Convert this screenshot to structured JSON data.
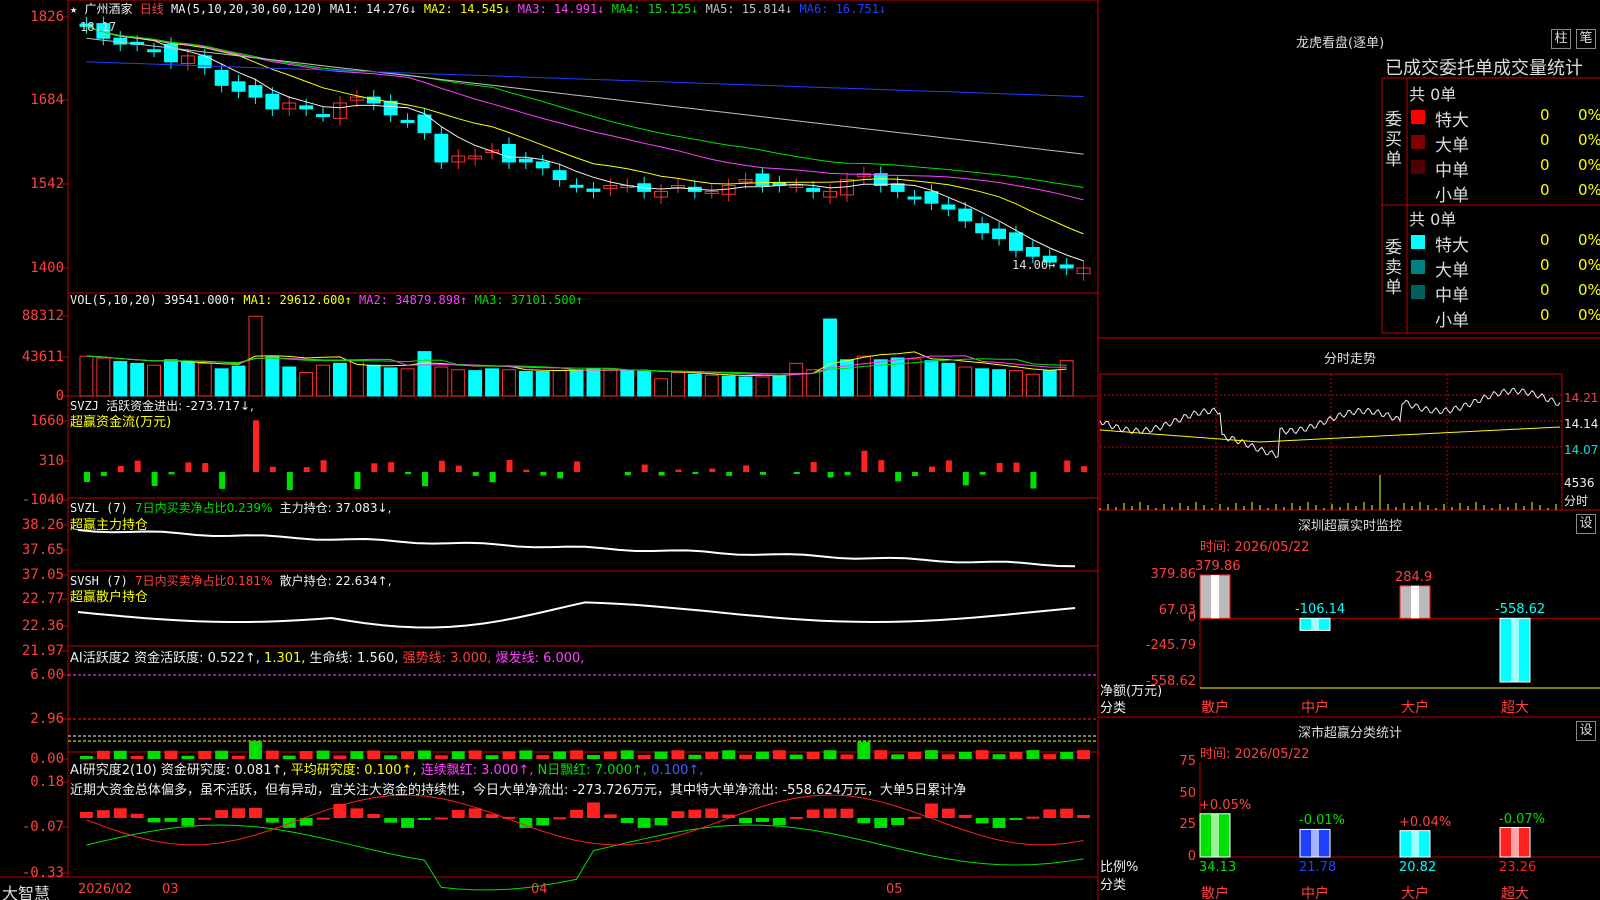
{
  "main_chart": {
    "star": "★",
    "stock_name": "广州酒家",
    "period": "日线",
    "ma_label": "MA(5,10,20,30,60,120)",
    "ma_values": [
      {
        "label": "MA1: 14.276↓",
        "color": "#f0f0f0"
      },
      {
        "label": "MA2: 14.545↓",
        "color": "#ffff00"
      },
      {
        "label": "MA3: 14.991↓",
        "color": "#ff40ff"
      },
      {
        "label": "MA4: 15.125↓",
        "color": "#00e000"
      },
      {
        "label": "MA5: 15.814↓",
        "color": "#c0c0c0"
      },
      {
        "label": "MA6: 16.751↓",
        "color": "#2040ff"
      }
    ],
    "y_ticks": [
      "1826",
      "1684",
      "1542",
      "1400"
    ],
    "top_note": "18.17",
    "last_note": "14.00→"
  },
  "volume": {
    "header": "VOL(5,10,20)",
    "value": "39541.000↑",
    "ma1": "MA1: 29612.600↑",
    "ma2": "MA2: 34879.898↑",
    "ma3": "MA3: 37101.500↑",
    "y_ticks": [
      "88312",
      "43611",
      "0"
    ]
  },
  "svzj": {
    "header": "SVZJ",
    "desc": "活跃资金进出: -273.717↓,",
    "sub": "超赢资金流(万元)",
    "y_ticks": [
      "1660",
      "310",
      "-1040"
    ]
  },
  "svzl": {
    "header": "SVZL (7)",
    "ratio": "7日内买卖净占比0.239%",
    "hold": "主力持仓: 37.083↓,",
    "sub": "超赢主力持仓",
    "y_ticks": [
      "38.26",
      "37.65",
      "37.05"
    ]
  },
  "svsh": {
    "header": "SVSH (7)",
    "ratio": "7日内买卖净占比0.181%",
    "hold": "散户持仓: 22.634↑,",
    "sub": "超赢散户持仓",
    "y_ticks": [
      "22.77",
      "22.36",
      "21.97"
    ]
  },
  "ai_active": {
    "header": "AI活跃度2",
    "val1": "资金活跃度: 0.522↑,",
    "val2": "1.301,",
    "val3": "生命线: 1.560,",
    "val4": "强势线: 3.000,",
    "val5": "爆发线: 6.000,",
    "y_ticks": [
      "6.00",
      "2.96",
      "0.00"
    ]
  },
  "ai_research": {
    "header": "AI研究度2(10)",
    "val1": "资金研究度: 0.081↑,",
    "val2": "平均研究度: 0.100↑,",
    "val3": "连续飘红: 3.000↑,",
    "val4": "N日飘红: 7.000↑,",
    "val5": "0.100↑,",
    "text": "近期大资金总体偏多，虽不活跃，但有异动，宜关注大资金的持续性，今日大单净流出: -273.726万元，其中特大单净流出: -558.624万元，大单5日累计净",
    "y_ticks": [
      "0.18",
      "-0.07",
      "-0.33"
    ]
  },
  "x_axis": {
    "brand": "大智慧",
    "labels": [
      "2026/02",
      "03",
      "04",
      "05"
    ]
  },
  "longhu": {
    "title": "龙虎看盘(逐单)",
    "btn1": "柱",
    "btn2": "笔",
    "tabs": "已成交委托单成交量统计",
    "buy_label": "委买单",
    "sell_label": "委卖单",
    "buy_total": "共 0单",
    "sell_total": "共 0单",
    "buy_rows": [
      {
        "name": "特大",
        "count": "0",
        "pct": "0%",
        "color": "#ff0000"
      },
      {
        "name": "大单",
        "count": "0",
        "pct": "0%",
        "color": "#800000"
      },
      {
        "name": "中单",
        "count": "0",
        "pct": "0%",
        "color": "#500000"
      },
      {
        "name": "小单",
        "count": "0",
        "pct": "0%",
        "color": "#000000"
      }
    ],
    "sell_rows": [
      {
        "name": "特大",
        "count": "0",
        "pct": "0%",
        "color": "#00ffff"
      },
      {
        "name": "大单",
        "count": "0",
        "pct": "0%",
        "color": "#008080"
      },
      {
        "name": "中单",
        "count": "0",
        "pct": "0%",
        "color": "#006060"
      },
      {
        "name": "小单",
        "count": "0",
        "pct": "0%",
        "color": "#000000"
      }
    ]
  },
  "intraday": {
    "title": "分时走势",
    "y_ticks": [
      "14.21",
      "14.14",
      "14.07"
    ],
    "vol_label": "4536",
    "unit_label": "分时"
  },
  "sz_monitor": {
    "title": "深圳超赢实时监控",
    "btn": "设",
    "date_label": "时间: 2026/05/22",
    "y_ticks": [
      "379.86",
      "67.03",
      "0",
      "-245.79",
      "-558.62"
    ],
    "y_label": "净额(万元)",
    "x_label": "分类",
    "categories": [
      "散户",
      "中户",
      "大户",
      "超大"
    ],
    "values": [
      379.86,
      -106.14,
      284.9,
      -558.62
    ],
    "value_labels": [
      "379.86",
      "-106.14",
      "284.9",
      "-558.62"
    ]
  },
  "sz_classify": {
    "title": "深市超赢分类统计",
    "btn": "设",
    "date_label": "时间: 2026/05/22",
    "y_ticks": [
      "75",
      "50",
      "25",
      "0"
    ],
    "y_label": "比例%",
    "x_label": "分类",
    "categories": [
      "散户",
      "中户",
      "大户",
      "超大"
    ],
    "values": [
      34.13,
      21.78,
      20.82,
      23.26
    ],
    "changes": [
      "+0.05%",
      "-0.01%",
      "+0.04%",
      "-0.07%"
    ],
    "colors": [
      "#00e000",
      "#2040ff",
      "#00ffff",
      "#ff2020"
    ]
  },
  "chart_data": [
    {
      "type": "candlestick",
      "title": "广州酒家 日线",
      "ylim": [
        1400,
        1826
      ],
      "note": "k-line with MA5/10/20/30/60/120",
      "closes_approx": [
        18.1,
        17.9,
        17.8,
        17.8,
        17.7,
        17.5,
        17.6,
        17.4,
        17.1,
        17.0,
        16.9,
        16.7,
        16.8,
        16.7,
        16.6,
        16.8,
        16.9,
        16.8,
        16.6,
        16.5,
        16.3,
        15.8,
        15.9,
        15.9,
        16.0,
        15.8,
        15.8,
        15.7,
        15.5,
        15.4,
        15.3,
        15.4,
        15.4,
        15.3,
        15.3,
        15.4,
        15.3,
        15.3,
        15.4,
        15.5,
        15.4,
        15.4,
        15.4,
        15.3,
        15.3,
        15.5,
        15.6,
        15.4,
        15.3,
        15.2,
        15.1,
        15.0,
        14.8,
        14.6,
        14.5,
        14.3,
        14.2,
        14.1,
        14.0,
        14.0
      ]
    },
    {
      "type": "bar",
      "title": "VOL(5,10,20)",
      "ylim": [
        0,
        88312
      ],
      "values_approx": [
        44,
        42,
        38,
        36,
        34,
        40,
        37,
        36,
        30,
        33,
        88,
        43,
        32,
        26,
        34,
        36,
        39,
        34,
        31,
        30,
        49,
        32,
        29,
        28,
        30,
        29,
        27,
        27,
        28,
        29,
        30,
        30,
        28,
        27,
        19,
        26,
        24,
        23,
        22,
        21,
        21,
        22,
        36,
        29,
        85,
        40,
        44,
        40,
        42,
        41,
        39,
        36,
        32,
        30,
        29,
        28,
        24,
        28,
        39
      ]
    }
  ]
}
